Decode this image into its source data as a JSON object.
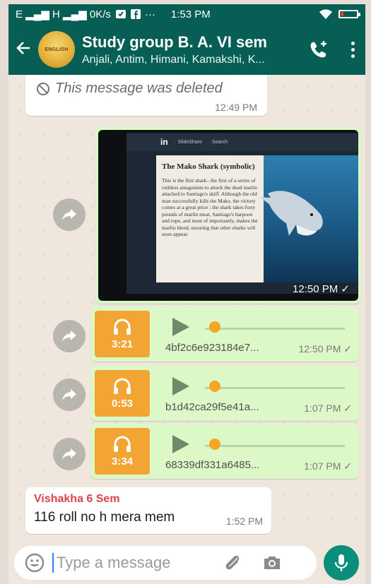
{
  "status": {
    "left": "E ▂▄▆ H ▂▄▆ 0K/s",
    "time": "1:53 PM",
    "dots": "···"
  },
  "header": {
    "title": "Study group B. A. VI sem",
    "subtitle": "Anjali, Antim, Himani, Kamakshi, K...",
    "avatar_text": "ENGLISH"
  },
  "messages": {
    "deleted": {
      "text": "This message was deleted",
      "time": "12:49 PM"
    },
    "image": {
      "time": "12:50 PM ✓",
      "doc_title": "The Mako Shark (symbolic)",
      "doc_text": "This is the first shark– the first of a series of ruthless antagonists to attack the dead marlin attached to Santiago's skiff. Although the old man successfully kills the Mako, the victory comes at a great price : the shark takes forty pounds of marlin meat, Santiago's harpoon and rope, and most of importantly, makes the marlin bleed, ensuring that other sharks will soon appear.",
      "site_logo": "in",
      "site_name": "SlideShare",
      "site_nav": "Search"
    },
    "audio": [
      {
        "duration": "3:21",
        "file": "4bf2c6e923184e7...",
        "time": "12:50 PM ✓"
      },
      {
        "duration": "0:53",
        "file": "b1d42ca29f5e41a...",
        "time": "1:07 PM ✓"
      },
      {
        "duration": "3:34",
        "file": "68339df331a6485...",
        "time": "1:07 PM ✓"
      }
    ],
    "vishakha": {
      "sender": "Vishakha 6 Sem",
      "text": "116 roll no h mera mem",
      "time": "1:52 PM"
    }
  },
  "input": {
    "placeholder": "Type a message"
  },
  "colors": {
    "header": "#075e54",
    "outgoing": "#dcf8c6",
    "audio_thumb": "#f3a533",
    "mic": "#0b8f7c",
    "sender": "#d9434a"
  }
}
